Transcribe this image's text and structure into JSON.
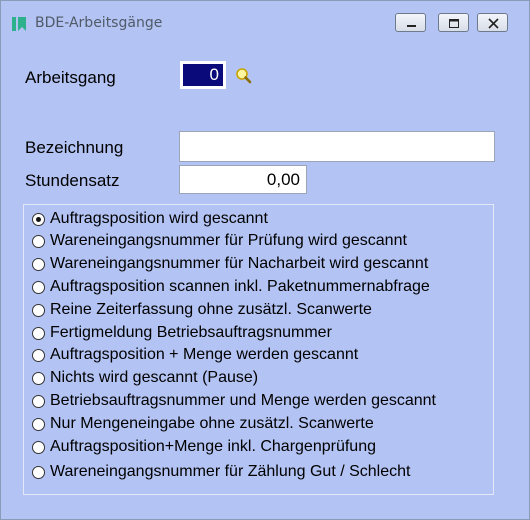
{
  "window": {
    "title": "BDE-Arbeitsgänge",
    "icon": "bookmark-icon",
    "accent": "#2db08c",
    "background": "#b3c3f3",
    "buttons": {
      "minimize": "minimize-icon",
      "maximize": "maximize-icon",
      "close": "close-icon"
    }
  },
  "form": {
    "arbeitsgang": {
      "label": "Arbeitsgang",
      "value": "0",
      "lookup_icon": "magnifier-icon"
    },
    "bezeichnung": {
      "label": "Bezeichnung",
      "value": ""
    },
    "stundensatz": {
      "label": "Stundensatz",
      "value": "0,00"
    }
  },
  "options": [
    {
      "label": "Auftragsposition wird gescannt",
      "selected": true
    },
    {
      "label": "Wareneingangsnummer für Prüfung wird gescannt",
      "selected": false
    },
    {
      "label": "Wareneingangsnummer für Nacharbeit wird gescannt",
      "selected": false
    },
    {
      "label": "Auftragsposition scannen inkl. Paketnummernabfrage",
      "selected": false
    },
    {
      "label": "Reine Zeiterfassung ohne zusätzl. Scanwerte",
      "selected": false
    },
    {
      "label": "Fertigmeldung Betriebsauftragsnummer",
      "selected": false
    },
    {
      "label": "Auftragsposition + Menge werden gescannt",
      "selected": false
    },
    {
      "label": "Nichts wird gescannt (Pause)",
      "selected": false
    },
    {
      "label": "Betriebsauftragsnummer und Menge werden gescannt",
      "selected": false
    },
    {
      "label": "Nur Mengeneingabe ohne zusätzl. Scanwerte",
      "selected": false
    },
    {
      "label": "Auftragsposition+Menge inkl. Chargenprüfung",
      "selected": false
    },
    {
      "label": "Wareneingangsnummer für Zählung Gut / Schlecht",
      "selected": false
    }
  ]
}
